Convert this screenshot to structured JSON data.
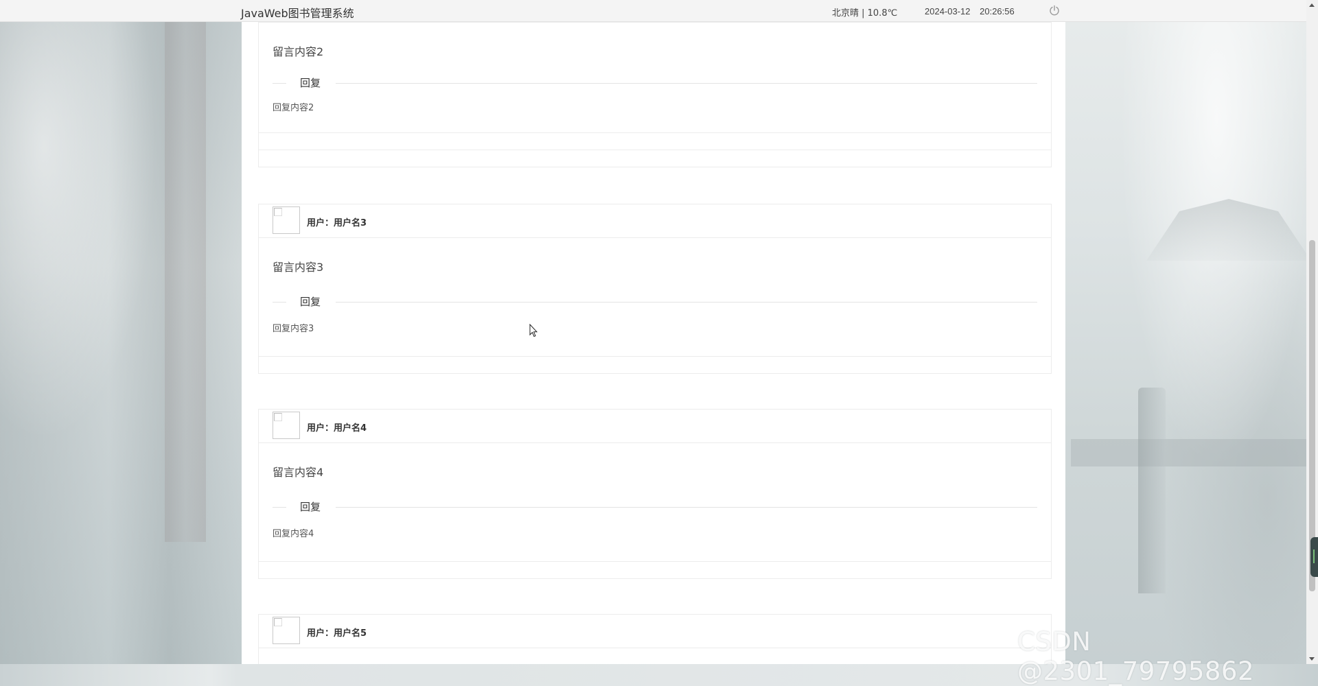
{
  "header": {
    "app_title": "JavaWeb图书管理系统",
    "weather": "北京晴 | 10.8℃",
    "date": "2024-03-12",
    "time": "20:26:56",
    "power_icon": "power-icon"
  },
  "messages": [
    {
      "user_label": "",
      "content": "留言内容2",
      "reply_title": "回复",
      "reply_content": "回复内容2"
    },
    {
      "user_label": "用户：用户名3",
      "content": "留言内容3",
      "reply_title": "回复",
      "reply_content": "回复内容3"
    },
    {
      "user_label": "用户：用户名4",
      "content": "留言内容4",
      "reply_title": "回复",
      "reply_content": "回复内容4"
    },
    {
      "user_label": "用户：用户名5",
      "content": "",
      "reply_title": "",
      "reply_content": ""
    }
  ],
  "watermark": "CSDN @2301_79795862"
}
